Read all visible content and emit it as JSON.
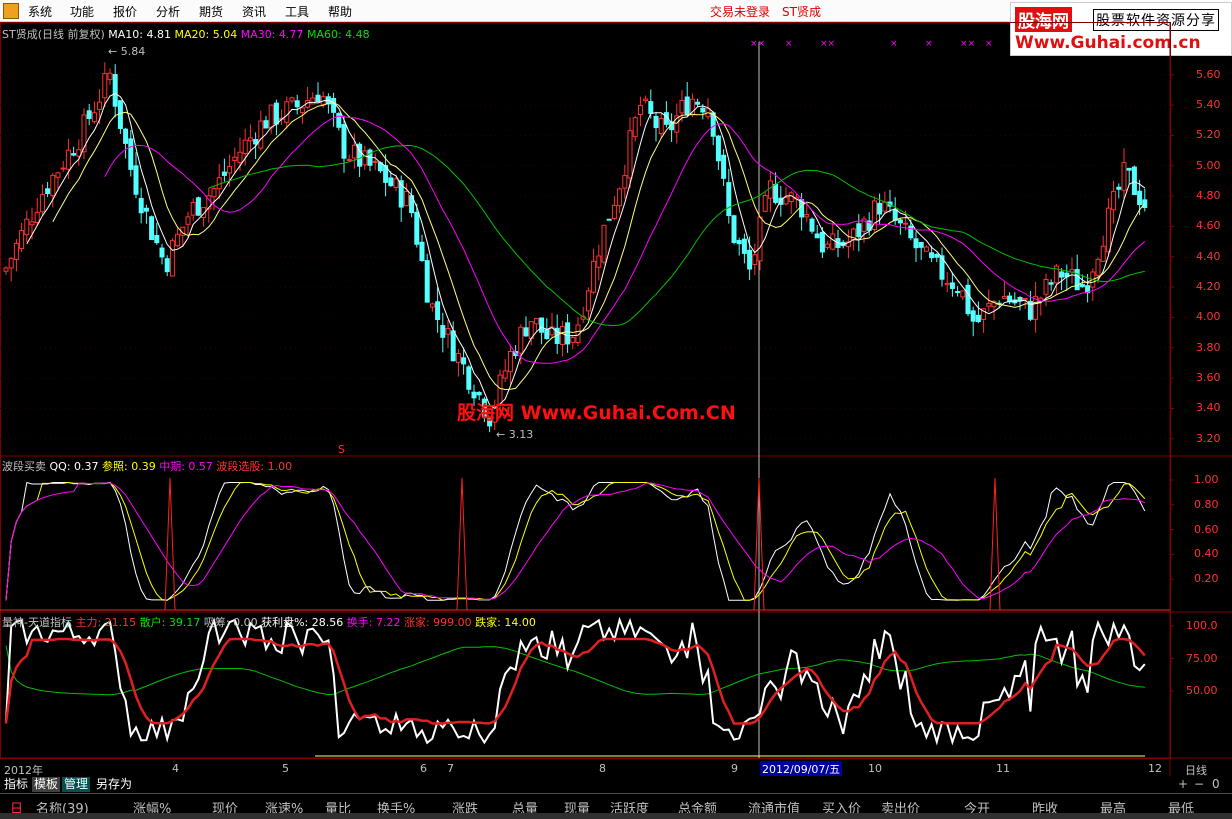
{
  "menu": {
    "items": [
      "系统",
      "功能",
      "报价",
      "分析",
      "期货",
      "资讯",
      "工具",
      "帮助"
    ],
    "status": "交易未登录",
    "stock_name": "ST贤成"
  },
  "logo": {
    "name": "股海网",
    "tagline": "股票软件资源分享",
    "url": "Www.Guhai.com.cn"
  },
  "main_panel": {
    "title": "ST贤成(日线 前复权)",
    "ma_labels": [
      "MA10: 4.81",
      "MA20: 5.04",
      "MA30: 4.77",
      "MA60: 4.48"
    ],
    "price_high": "5.84",
    "price_low": "3.13",
    "y_ticks": [
      "5.60",
      "5.40",
      "5.20",
      "5.00",
      "4.80",
      "4.60",
      "4.40",
      "4.20",
      "4.00",
      "3.80",
      "3.60",
      "3.40",
      "3.20"
    ],
    "marker": "S"
  },
  "watermark": "股海网 Www.Guhai.Com.CN",
  "panel2": {
    "title": "波段买卖",
    "labels": [
      "QQ: 0.37",
      "参照: 0.39",
      "中期: 0.57",
      "波段选股: 1.00"
    ],
    "y_ticks": [
      "1.00",
      "0.80",
      "0.60",
      "0.40",
      "0.20"
    ]
  },
  "panel3": {
    "title": "量神-天道指标",
    "labels": [
      "主力: 21.15",
      "散户: 39.17",
      "吸筹: 0.00",
      "获利盘%: 28.56",
      "换手: 7.22",
      "涨家: 999.00",
      "跌家: 14.00"
    ],
    "y_ticks": [
      "100.0",
      "75.00",
      "50.00"
    ]
  },
  "x_axis": {
    "labels": [
      "2012年",
      "4",
      "5",
      "6",
      "7",
      "8",
      "9",
      "10",
      "11",
      "12"
    ],
    "cursor_date": "2012/09/07/五",
    "period": "日线"
  },
  "tabs": [
    "指标",
    "模板",
    "管理",
    "另存为"
  ],
  "table_header": [
    "名称(39)",
    "涨幅%",
    "现价",
    "涨速%",
    "量比",
    "换手%",
    "涨跌",
    "总量",
    "现量",
    "活跃度",
    "总金额",
    "流通市值",
    "买入价",
    "卖出价",
    "今开",
    "昨收",
    "最高",
    "最低"
  ],
  "colors": {
    "up": "#ff3232",
    "down": "#54ffff",
    "ma10": "#ffffff",
    "ma20": "#ffff00",
    "ma30": "#ff00ff",
    "ma60": "#00c000",
    "grid": "#800000"
  }
}
